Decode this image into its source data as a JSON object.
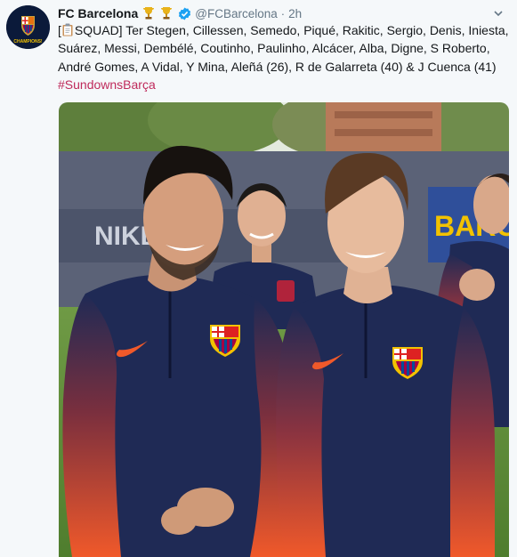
{
  "account": {
    "name": "FC Barcelona",
    "handle": "@FCBarcelona",
    "separator": "·",
    "time": "2h",
    "avatar_label": "CHAMPIONS!"
  },
  "tweet": {
    "text_line1": "SQUAD] Ter Stegen, Cillessen, Semedo, Piqué, Rakitic, Sergio, Denis, Iniesta,",
    "bracket_open": "[",
    "text_line2": "Suárez, Messi, Dembélé, Coutinho, Paulinho, Alcácer, Alba, Digne, S Roberto,",
    "text_line3": "André Gomes, A Vidal, Y Mina, Aleñá (26), R de Galarreta (40) & J Cuenca (41)",
    "hashtag": "#SundownsBarça"
  },
  "photo": {
    "banner_text_left": "NIKE",
    "banner_text_right": "BARCE"
  },
  "colors": {
    "hashtag": "#bf2a5b",
    "verified": "#1da1f2",
    "jersey": "#1f2a55",
    "jersey_accent": "#f0592a"
  },
  "icons": [
    "trophy-icon",
    "verified-icon",
    "clipboard-icon",
    "chevron-down-icon",
    "nike-swoosh-icon",
    "fcb-crest-icon"
  ]
}
